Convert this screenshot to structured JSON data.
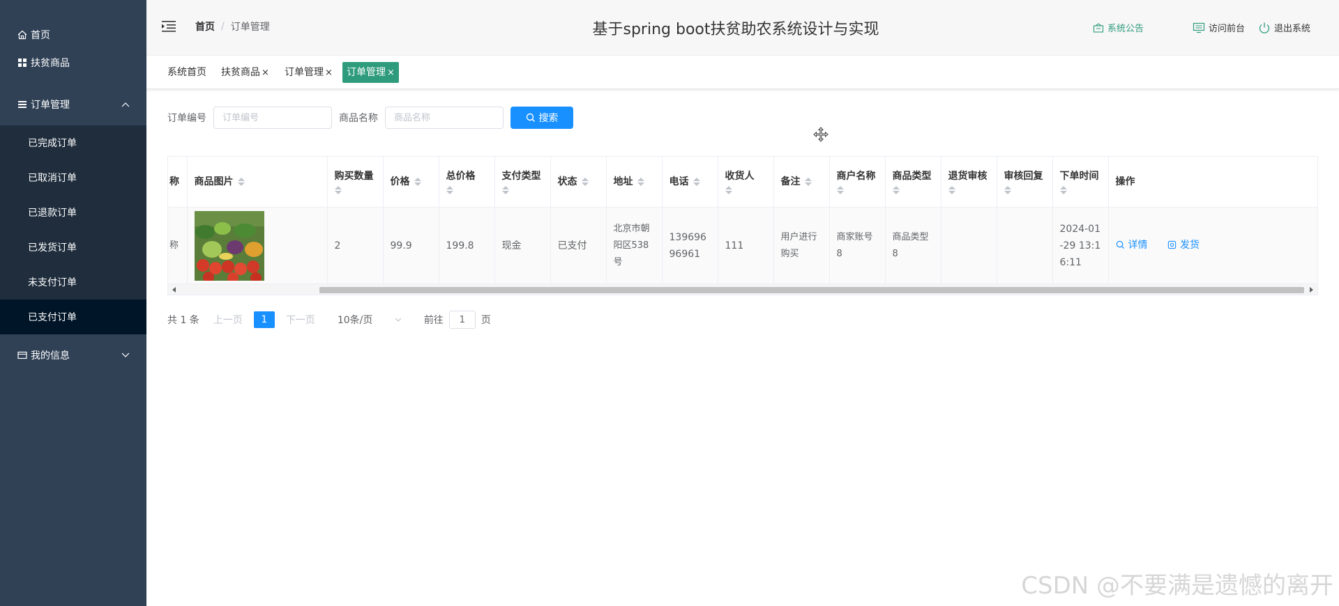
{
  "sidebar": {
    "items": [
      {
        "label": "首页"
      },
      {
        "label": "扶贫商品"
      },
      {
        "label": "订单管理"
      },
      {
        "label": "我的信息"
      }
    ],
    "order_submenu": [
      {
        "label": "已完成订单"
      },
      {
        "label": "已取消订单"
      },
      {
        "label": "已退款订单"
      },
      {
        "label": "已发货订单"
      },
      {
        "label": "未支付订单"
      },
      {
        "label": "已支付订单"
      }
    ]
  },
  "header": {
    "breadcrumb_home": "首页",
    "breadcrumb_sep": "/",
    "breadcrumb_current": "订单管理",
    "title": "基于spring boot扶贫助农系统设计与实现",
    "notice_label": "系统公告",
    "front_label": "访问前台",
    "logout_label": "退出系统"
  },
  "tabs": [
    {
      "label": "系统首页",
      "closable": false
    },
    {
      "label": "扶贫商品",
      "closable": true
    },
    {
      "label": "订单管理",
      "closable": true
    },
    {
      "label": "订单管理",
      "closable": true,
      "active": true
    }
  ],
  "tab_close_glyph": "×",
  "search": {
    "order_no_label": "订单编号",
    "order_no_placeholder": "订单编号",
    "product_name_label": "商品名称",
    "product_name_placeholder": "商品名称",
    "button_label": "搜索"
  },
  "table": {
    "columns": [
      "称",
      "商品图片",
      "购买数量",
      "价格",
      "总价格",
      "支付类型",
      "状态",
      "地址",
      "电话",
      "收货人",
      "备注",
      "商户名称",
      "商品类型",
      "退货审核",
      "审核回复",
      "下单时间",
      "操作"
    ],
    "rows": [
      {
        "name_tail": "称",
        "quantity": "2",
        "price": "99.9",
        "total": "199.8",
        "pay_type": "现金",
        "status": "已支付",
        "address": "北京市朝阳区538号",
        "phone": "13969696961",
        "receiver": "111",
        "remark": "用户进行购买",
        "merchant": "商家账号8",
        "product_type": "商品类型8",
        "return_review": "",
        "review_reply": "",
        "order_time": "2024-01-29 13:16:11",
        "op_detail": "详情",
        "op_ship": "发货"
      }
    ]
  },
  "pager": {
    "total_text": "共 1 条",
    "prev_label": "上一页",
    "current_page": "1",
    "next_label": "下一页",
    "page_size": "10条/页",
    "goto_label": "前往",
    "goto_value": "1",
    "page_unit": "页"
  },
  "watermark": "CSDN @不要满是遗憾的离开",
  "colors": {
    "sidebar_bg": "#304156",
    "submenu_bg": "#1f2d3d",
    "active_submenu_bg": "#001528",
    "primary": "#1890ff",
    "active_tab": "#2e9b7c",
    "header_link_green": "#2e9b7c"
  }
}
